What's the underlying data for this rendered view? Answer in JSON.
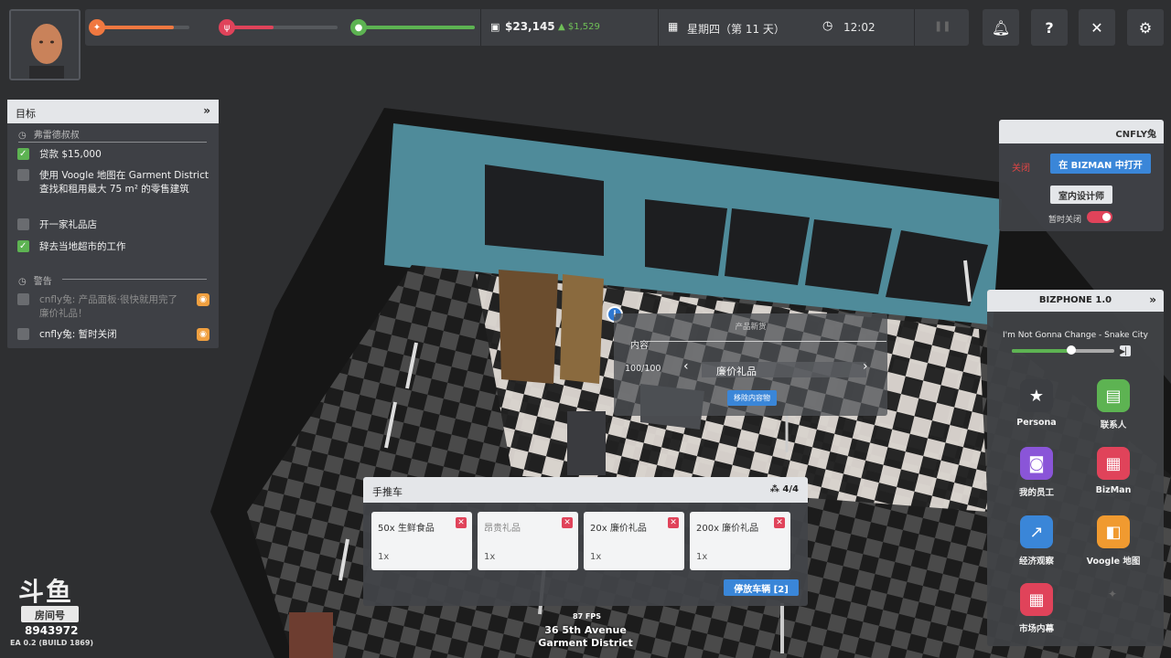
{
  "hud": {
    "money": "$23,145",
    "money_delta": "▲ $1,529",
    "date": "星期四（第 11 天）",
    "time": "12:02",
    "needs": [
      {
        "icon": "flame-icon",
        "color": "#f07840",
        "fill": 0.83
      },
      {
        "icon": "food-icon",
        "color": "#e0435a",
        "fill": 0.42
      },
      {
        "icon": "energy-icon",
        "color": "#5db352",
        "fill": 1.0
      }
    ]
  },
  "objectives": {
    "title": "目标",
    "section1": "弗雷德叔叔",
    "items1": [
      {
        "text": "贷款 $15,000",
        "done": true
      },
      {
        "text": "使用 Voogle 地图在 Garment District 查找和租用最大 75 m² 的零售建筑",
        "done": false
      },
      {
        "text": "开一家礼品店",
        "done": false
      },
      {
        "text": "辞去当地超市的工作",
        "done": true
      }
    ],
    "section2": "警告",
    "items2": [
      {
        "text": "cnfly兔: 产品面板·很快就用完了廉价礼品！",
        "dim": true
      },
      {
        "text": "cnfly兔: 暂时关闭",
        "dim": false
      }
    ]
  },
  "store": {
    "name": "CNFLY兔",
    "status": "关闭",
    "open_bizman": "在 BIZMAN 中打开",
    "interior": "室内设计师",
    "temp_close": "暂时关闭"
  },
  "phone": {
    "title": "BIZPHONE 1.0",
    "song": "I'm Not Gonna Change - Snake City",
    "song_progress": 0.58,
    "apps": [
      {
        "label": "Persona",
        "icon": "star-icon",
        "glyph": "★",
        "color": "#3c3e42"
      },
      {
        "label": "联系人",
        "icon": "chat-icon",
        "glyph": "▤",
        "color": "#5db352"
      },
      {
        "label": "我的员工",
        "icon": "badge-icon",
        "glyph": "◙",
        "color": "#8a55d8"
      },
      {
        "label": "BizMan",
        "icon": "shop-icon",
        "glyph": "▦",
        "color": "#e0435a"
      },
      {
        "label": "经济观察",
        "icon": "trend-icon",
        "glyph": "↗",
        "color": "#3a86d8"
      },
      {
        "label": "Voogle 地图",
        "icon": "map-icon",
        "glyph": "◧",
        "color": "#f09a30"
      },
      {
        "label": "市场内幕",
        "icon": "market-icon",
        "glyph": "▦",
        "color": "#e0435a"
      }
    ]
  },
  "popup": {
    "title": "产品新货",
    "label": "内容",
    "count": "100/100",
    "product": "廉价礼品",
    "remove": "移除内容物"
  },
  "cart": {
    "title": "手推车",
    "count": "4/4",
    "slots": [
      {
        "name": "50x 生鲜食品",
        "qty": "1x",
        "empty": false
      },
      {
        "name": "昂贵礼品",
        "qty": "1x",
        "empty": true
      },
      {
        "name": "20x 廉价礼品",
        "qty": "1x",
        "empty": false
      },
      {
        "name": "200x 廉价礼品",
        "qty": "1x",
        "empty": false
      }
    ],
    "park": "停放车辆 [2]"
  },
  "footer": {
    "fps": "87 FPS",
    "street": "36 5th Avenue",
    "district": "Garment District",
    "build": "EA 0.2 (BUILD 1869)"
  },
  "watermark": {
    "logo": "斗鱼",
    "tag": "房间号",
    "room": "8943972"
  }
}
